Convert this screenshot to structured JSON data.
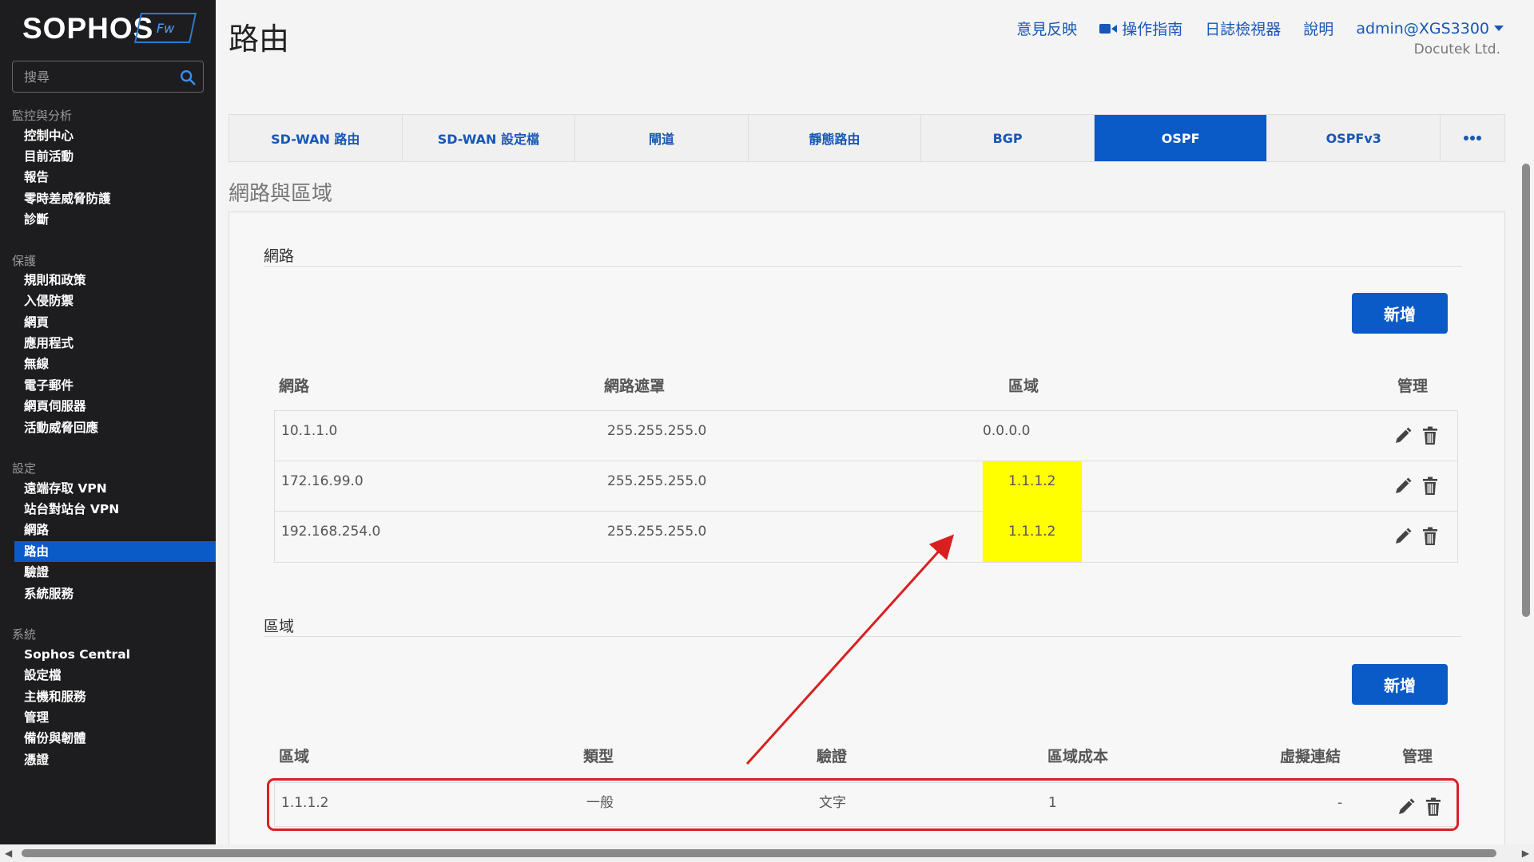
{
  "brand": {
    "name": "SOPHOS",
    "badge": "Fw"
  },
  "search": {
    "placeholder": "搜尋"
  },
  "sidebar": {
    "groups": [
      {
        "title": "監控與分析",
        "items": [
          "控制中心",
          "目前活動",
          "報告",
          "零時差威脅防護",
          "診斷"
        ]
      },
      {
        "title": "保護",
        "items": [
          "規則和政策",
          "入侵防禦",
          "網頁",
          "應用程式",
          "無線",
          "電子郵件",
          "網頁伺服器",
          "活動威脅回應"
        ]
      },
      {
        "title": "設定",
        "items": [
          "遠端存取 VPN",
          "站台對站台 VPN",
          "網路",
          "路由",
          "驗證",
          "系統服務"
        ]
      },
      {
        "title": "系統",
        "items": [
          "Sophos Central",
          "設定檔",
          "主機和服務",
          "管理",
          "備份與韌體",
          "憑證"
        ]
      }
    ],
    "active": "路由"
  },
  "header": {
    "title": "路由",
    "links": {
      "feedback": "意見反映",
      "guide": "操作指南",
      "log_viewer": "日誌檢視器",
      "help": "說明",
      "user": "admin@XGS3300"
    },
    "company": "Docutek Ltd."
  },
  "tabs": [
    "SD-WAN 路由",
    "SD-WAN 設定檔",
    "閘道",
    "靜態路由",
    "BGP",
    "OSPF",
    "OSPFv3"
  ],
  "active_tab": "OSPF",
  "section_title": "網路與區域",
  "network": {
    "title": "網路",
    "add_label": "新增",
    "headers": {
      "network": "網路",
      "netmask": "網路遮罩",
      "area": "區域",
      "manage": "管理"
    },
    "rows": [
      {
        "network": "10.1.1.0",
        "netmask": "255.255.255.0",
        "area": "0.0.0.0",
        "highlight": false
      },
      {
        "network": "172.16.99.0",
        "netmask": "255.255.255.0",
        "area": "1.1.1.2",
        "highlight": true
      },
      {
        "network": "192.168.254.0",
        "netmask": "255.255.255.0",
        "area": "1.1.1.2",
        "highlight": true
      }
    ]
  },
  "area": {
    "title": "區域",
    "add_label": "新增",
    "headers": {
      "area": "區域",
      "type": "類型",
      "auth": "驗證",
      "cost": "區域成本",
      "virtual_link": "虛擬連結",
      "manage": "管理"
    },
    "rows": [
      {
        "area": "1.1.1.2",
        "type": "一般",
        "auth": "文字",
        "cost": "1",
        "virtual_link": "-"
      }
    ]
  },
  "colors": {
    "accent": "#0a5ac7",
    "link": "#1657b7",
    "highlight": "#ffff00",
    "annotation": "#d92020",
    "sidebar_bg": "#1d1d1f"
  }
}
